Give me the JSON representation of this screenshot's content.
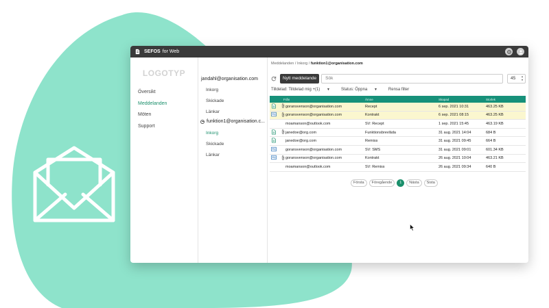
{
  "app": {
    "title_strong": "SEFOS",
    "title_rest": "for Web"
  },
  "nav": {
    "logo": "LOGOTYP",
    "items": [
      {
        "label": "Översikt",
        "active": false
      },
      {
        "label": "Meddelanden",
        "active": true
      },
      {
        "label": "Möten",
        "active": false
      },
      {
        "label": "Support",
        "active": false
      }
    ]
  },
  "breadcrumb": {
    "part1": "Meddelanden",
    "sep1": "/",
    "part2": "Inkorg",
    "sep2": "/",
    "current": "funktion1@organisation.com"
  },
  "accounts": {
    "primary": {
      "email": "jandahl@organisation.com",
      "folders": [
        "Inkorg",
        "Skickade",
        "Länkar"
      ]
    },
    "function": {
      "email": "funktion1@organisation.c...",
      "folders": [
        "Inkorg",
        "Skickade",
        "Länkar"
      ],
      "active_folder": "Inkorg"
    }
  },
  "toolbar": {
    "new_message": "Nytt meddelande",
    "search_placeholder": "Sök",
    "page_size": "45"
  },
  "filters": {
    "assigned": "Tilldelad: Tilldelad mig +(1)",
    "status": "Status: Öppna",
    "clear": "Rensa filter"
  },
  "table": {
    "headers": {
      "from": "Från",
      "subject": "Ämne",
      "created": "Skapad",
      "size": "Storlek"
    },
    "rows": [
      {
        "icon": "reply-icon",
        "attachment": true,
        "from": "goransvenson@organisation.com",
        "subject": "Recept",
        "created": "6 sep. 2021 10:31",
        "size": "463.25 KB",
        "highlight": true
      },
      {
        "icon": "contact-icon",
        "attachment": true,
        "from": "goransvenson@organisation.com",
        "subject": "Kontrakt",
        "created": "6 sep. 2021 08:15",
        "size": "463.25 KB",
        "highlight": true
      },
      {
        "icon": "none",
        "attachment": false,
        "from": "moamanson@outlook.com",
        "subject": "SV: Recept",
        "created": "1 sep. 2021 15:45",
        "size": "463.19 KB",
        "highlight": false
      },
      {
        "icon": "reply-icon",
        "attachment": true,
        "from": "janedoe@org.com",
        "subject": "Funktionsbrevlåda",
        "created": "31 aug. 2021 14:04",
        "size": "684 B",
        "highlight": false
      },
      {
        "icon": "reply-icon",
        "attachment": false,
        "from": "janedoe@org.com",
        "subject": "Remiss",
        "created": "31 aug. 2021 09:45",
        "size": "664 B",
        "highlight": false
      },
      {
        "icon": "contact-icon",
        "attachment": false,
        "from": "goransvenson@organisation.com",
        "subject": "SV: SMS",
        "created": "31 aug. 2021 09:01",
        "size": "601.34 KB",
        "highlight": false
      },
      {
        "icon": "contact-icon",
        "attachment": true,
        "from": "goransvenson@organisation.com",
        "subject": "Kontrakt",
        "created": "26 aug. 2021 10:04",
        "size": "463.21 KB",
        "highlight": false
      },
      {
        "icon": "none",
        "attachment": false,
        "from": "moamanson@outlook.com",
        "subject": "SV: Remiss",
        "created": "26 aug. 2021 09:34",
        "size": "640 B",
        "highlight": false
      }
    ]
  },
  "pager": {
    "first": "Första",
    "prev": "Föregående",
    "current": "1",
    "next": "Nästa",
    "last": "Sista"
  },
  "colors": {
    "accent": "#1a8f6b",
    "header": "#17917a",
    "blob": "#8ee3cb",
    "highlight": "#fbf7cf",
    "titlebar": "#3a3a3a"
  }
}
